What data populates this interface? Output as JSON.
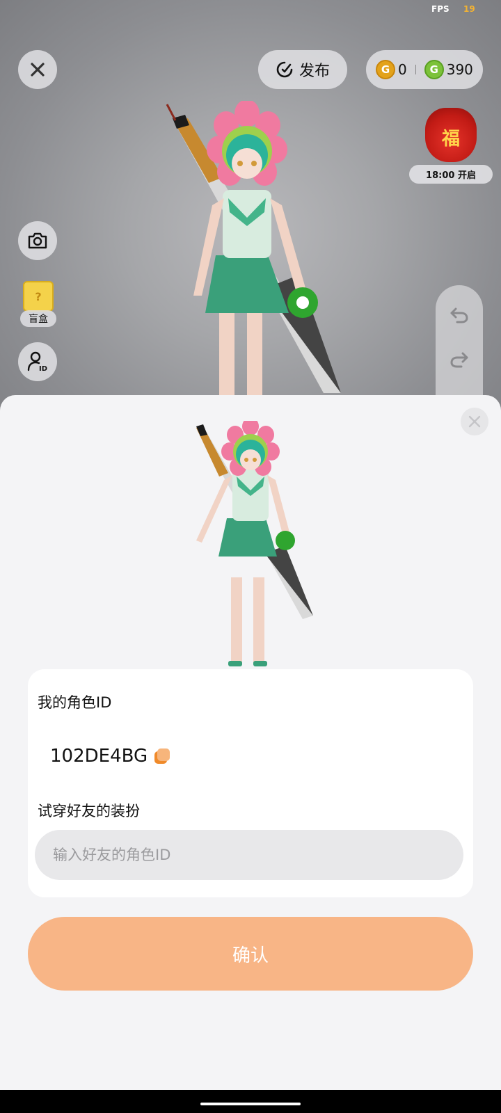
{
  "status": {
    "fps_label": "FPS",
    "fps_value": "19"
  },
  "toolbar": {
    "publish_label": "发布",
    "gold_coins": "0",
    "green_coins": "390"
  },
  "event": {
    "time_label": "18:00 开启",
    "bag_glyph": "福"
  },
  "side": {
    "blindbox_label": "盲盒"
  },
  "sheet": {
    "my_id_label": "我的角色ID",
    "my_id_value": "102DE4BG",
    "tryon_label": "试穿好友的装扮",
    "friend_id_placeholder": "输入好友的角色ID",
    "friend_id_value": "",
    "confirm_label": "确认"
  },
  "colors": {
    "accent": "#f8b586",
    "gold": "#e3a21a",
    "green": "#7cc23a",
    "character_skirt": "#3aa07a",
    "character_hair": "#2bb39a",
    "flower": "#f07aa0"
  }
}
